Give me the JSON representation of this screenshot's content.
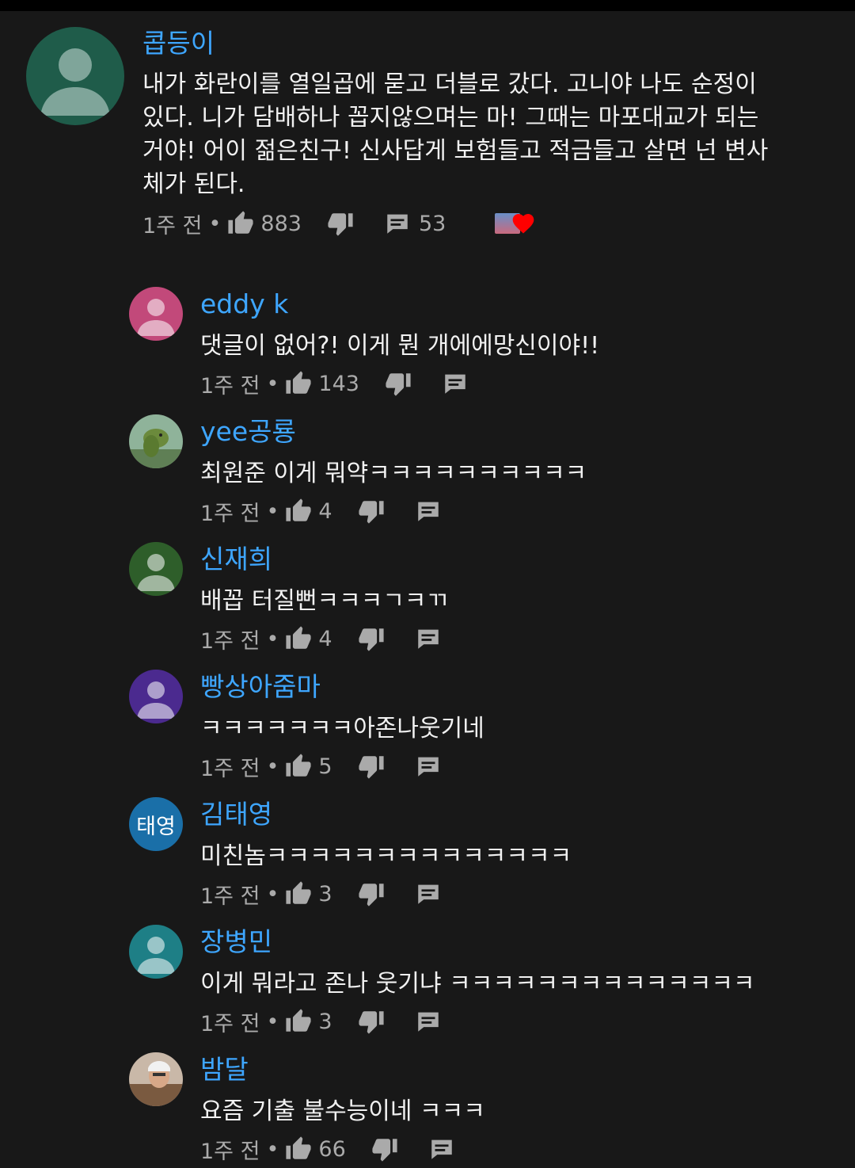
{
  "colors": {
    "background": "#181818",
    "author": "#3ea6ff",
    "text": "#f1f1f1",
    "meta": "#aaaaaa",
    "heart": "#ff0000"
  },
  "main_comment": {
    "author": "콥등이",
    "text_lines": [
      "내가 화란이를 열일곱에 묻고 더블로 갔다. 고니야 나도 순정이",
      "있다. 니가 담배하나 꼽지않으며는 마! 그때는 마포대교가 되는",
      "거야! 어이 젊은친구! 신사답게 보험들고 적금들고 살면 넌 변사",
      "체가 된다."
    ],
    "time": "1주 전",
    "likes": "883",
    "reply_count": "53",
    "avatar_color": "#1f5c4a",
    "icons": {
      "like": "thumbs-up-icon",
      "dislike": "thumbs-down-icon",
      "reply": "reply-icon",
      "heart": "creator-heart-icon"
    }
  },
  "replies": [
    {
      "author": "eddy k",
      "text": "댓글이 없어?! 이게 뭔 개에에망신이야!!",
      "time": "1주 전",
      "likes": "143",
      "avatar_color": "#c2497a",
      "avatar_kind": "default"
    },
    {
      "author": "yee공룡",
      "text": "최원준 이게 뭐약ㅋㅋㅋㅋㅋㅋㅋㅋㅋㅋ",
      "time": "1주 전",
      "likes": "4",
      "avatar_color": "#8fb39a",
      "avatar_kind": "dino"
    },
    {
      "author": "신재희",
      "text": "배꼽 터질뻔ㅋㅋㅋㄱㅋㄲ",
      "time": "1주 전",
      "likes": "4",
      "avatar_color": "#2e5e2a",
      "avatar_kind": "default"
    },
    {
      "author": "빵상아줌마",
      "text": "ㅋㅋㅋㅋㅋㅋㅋ아존나웃기네",
      "time": "1주 전",
      "likes": "5",
      "avatar_color": "#4b2a8f",
      "avatar_kind": "default"
    },
    {
      "author": "김태영",
      "text": "미친놈ㅋㅋㅋㅋㅋㅋㅋㅋㅋㅋㅋㅋㅋㅋ",
      "time": "1주 전",
      "likes": "3",
      "avatar_color": "#1a6fa8",
      "avatar_kind": "initials",
      "avatar_text": "태영"
    },
    {
      "author": "장병민",
      "text": "이게 뭐라고 존나 웃기냐 ㅋㅋㅋㅋㅋㅋㅋㅋㅋㅋㅋㅋㅋㅋ",
      "time": "1주 전",
      "likes": "3",
      "avatar_color": "#1e7f86",
      "avatar_kind": "default"
    },
    {
      "author": "밤달",
      "text": "요즘 기출 불수능이네 ㅋㅋㅋ",
      "time": "1주 전",
      "likes": "66",
      "avatar_color": "#8a6a55",
      "avatar_kind": "photo"
    }
  ]
}
